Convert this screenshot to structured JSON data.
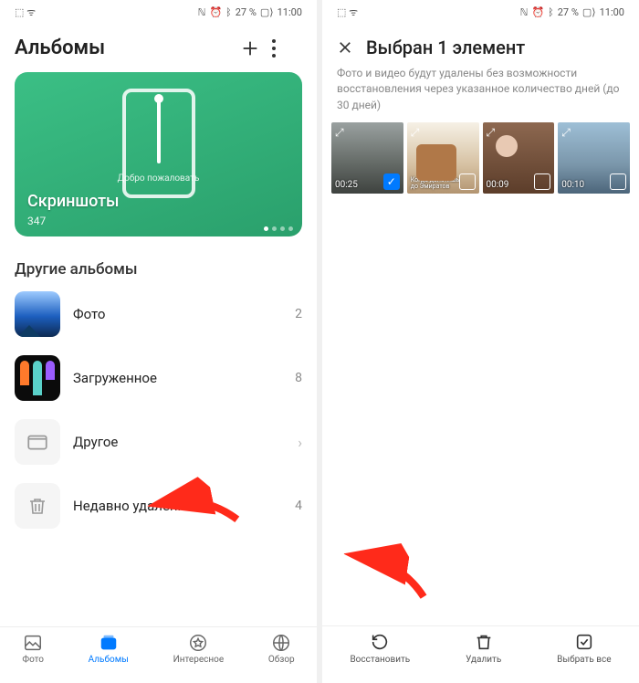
{
  "status": {
    "left": "⬚ ᯤ",
    "nfc": "ℕ",
    "alarm": "⏰",
    "bt": "ᛒ",
    "battery_pct": "27 %",
    "batt_icon": "▢⟩",
    "time": "11:00"
  },
  "left": {
    "title": "Альбомы",
    "card": {
      "welcome": "Добро пожаловать",
      "name": "Скриншоты",
      "count": "347"
    },
    "section_title": "Другие альбомы",
    "rows": [
      {
        "label": "Фото",
        "count": "2",
        "type": "photo"
      },
      {
        "label": "Загруженное",
        "count": "8",
        "type": "dl"
      },
      {
        "label": "Другое",
        "count": "",
        "type": "other",
        "chevron": "›"
      },
      {
        "label": "Недавно удаленное",
        "count": "4",
        "type": "trash"
      }
    ],
    "nav": [
      {
        "label": "Фото"
      },
      {
        "label": "Альбомы"
      },
      {
        "label": "Интересное"
      },
      {
        "label": "Обзор"
      }
    ]
  },
  "right": {
    "title": "Выбран 1 элемент",
    "desc": "Фото и видео будут удалены без возможности восстановления через указанное количество дней (до 30 дней)",
    "thumbs": [
      {
        "dur": "00:25",
        "selected": true
      },
      {
        "cap": "Когда долетишь до Эмиратов"
      },
      {
        "dur": "00:09"
      },
      {
        "dur": "00:10"
      }
    ],
    "actions": [
      {
        "label": "Восстановить"
      },
      {
        "label": "Удалить"
      },
      {
        "label": "Выбрать все"
      }
    ]
  }
}
